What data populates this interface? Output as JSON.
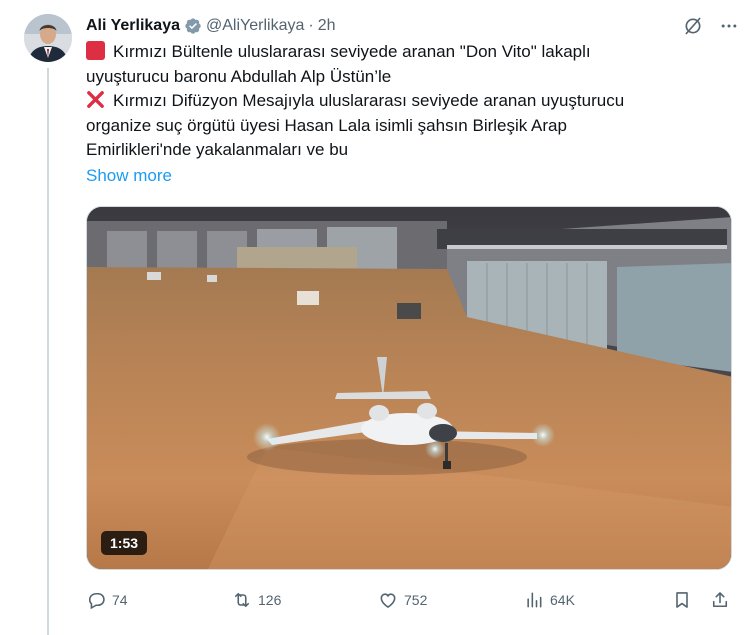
{
  "tweet": {
    "author_name": "Ali Yerlikaya",
    "handle": "@AliYerlikaya",
    "separator": "·",
    "time": "2h",
    "lines": [
      "Kırmızı Bültenle uluslararası seviyede aranan \"Don Vito\" lakaplı",
      "uyuşturucu baronu Abdullah Alp Üstün’le",
      "Kırmızı Difüzyon Mesajıyla uluslararası seviyede aranan uyuşturucu",
      "organize suç örgütü üyesi Hasan Lala isimli şahsın Birleşik Arap",
      "Emirlikleri'nde yakalanmaları ve bu"
    ],
    "show_more": "Show more",
    "video_duration": "1:53"
  },
  "actions": {
    "replies": "74",
    "retweets": "126",
    "likes": "752",
    "views": "64K"
  },
  "colors": {
    "accent": "#1d9bf0",
    "verified": "#829aab",
    "secondary_text": "#536471",
    "red_emoji": "#dd2e44"
  },
  "icons": [
    "verified-badge-icon",
    "grok-icon",
    "more-icon",
    "red-square-icon",
    "red-cross-icon",
    "reply-icon",
    "retweet-icon",
    "like-icon",
    "views-icon",
    "bookmark-icon",
    "share-icon"
  ]
}
